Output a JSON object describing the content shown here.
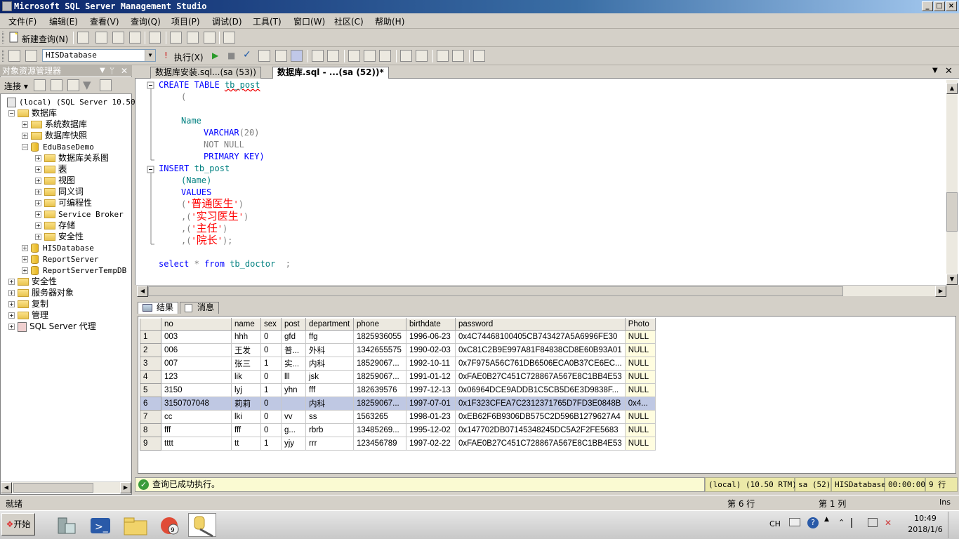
{
  "window": {
    "title": "Microsoft SQL Server Management Studio"
  },
  "menu": [
    "文件(F)",
    "编辑(E)",
    "查看(V)",
    "查询(Q)",
    "项目(P)",
    "调试(D)",
    "工具(T)",
    "窗口(W)",
    "社区(C)",
    "帮助(H)"
  ],
  "toolbar1": {
    "new_query": "新建查询(N)"
  },
  "toolbar2": {
    "database": "HISDatabase",
    "execute": "执行(X)"
  },
  "object_explorer": {
    "title": "对象资源管理器",
    "connect": "连接",
    "server": "(local) (SQL Server 10.50.",
    "databases": "数据库",
    "system_dbs": "系统数据库",
    "snapshots": "数据库快照",
    "edubase": "EduBaseDemo",
    "edu_children": [
      "数据库关系图",
      "表",
      "视图",
      "同义词",
      "可编程性",
      "Service Broker",
      "存储",
      "安全性"
    ],
    "other_dbs": [
      "HISDatabase",
      "ReportServer",
      "ReportServerTempDB"
    ],
    "top_nodes": [
      "安全性",
      "服务器对象",
      "复制",
      "管理",
      "SQL Server 代理"
    ]
  },
  "tabs": [
    {
      "label": "数据库安装.sql...(sa (53))"
    },
    {
      "label": "数据库.sql - ...(sa (52))*"
    }
  ],
  "code": {
    "l1_kw": "CREATE TABLE",
    "l1_id": "tb_post",
    "l2": "(",
    "l4": "Name",
    "l5_kw": "VARCHAR",
    "l5_rest": "(20)",
    "l6": "NOT NULL",
    "l7": "PRIMARY KEY)",
    "l8_kw": "INSERT",
    "l8_id": "tb_post",
    "l9": "(Name)",
    "l10": "VALUES",
    "v1": "普通医生",
    "v2": "实习医生",
    "v3": "主任",
    "v4": "院长",
    "sel_kw": "select",
    "sel_star": "*",
    "sel_from": "from",
    "sel_tbl": "tb_doctor",
    "sel_end": ";"
  },
  "results_tabs": {
    "results": "结果",
    "messages": "消息"
  },
  "grid": {
    "columns": [
      "no",
      "name",
      "sex",
      "post",
      "department",
      "phone",
      "birthdate",
      "password",
      "Photo"
    ],
    "rows": [
      [
        "1",
        "003",
        "hhh",
        "0",
        "gfd",
        "ffg",
        "1825936055",
        "1996-06-23",
        "0x4C74468100405CB743427A5A6996FE30",
        "NULL"
      ],
      [
        "2",
        "006",
        "王发",
        "0",
        "普...",
        "外科",
        "1342655575",
        "1990-02-03",
        "0xC81C2B9E997A81F84838CD8E60B93A01",
        "NULL"
      ],
      [
        "3",
        "007",
        "张三",
        "1",
        "实...",
        "内科",
        "18529067...",
        "1992-10-11",
        "0x7F975A56C761DB6506ECA0B37CE6EC...",
        "NULL"
      ],
      [
        "4",
        "123",
        "lik",
        "0",
        "lll",
        "jsk",
        "18259067...",
        "1991-01-12",
        "0xFAE0B27C451C728867A567E8C1BB4E53",
        "NULL"
      ],
      [
        "5",
        "3150",
        "lyj",
        "1",
        "yhn",
        "fff",
        "182639576",
        "1997-12-13",
        "0x06964DCE9ADDB1C5CB5D6E3D9838F...",
        "NULL"
      ],
      [
        "6",
        "3150707048",
        "莉莉",
        "0",
        "",
        "内科",
        "18259067...",
        "1997-07-01",
        "0x1F323CFEA7C2312371765D7FD3E0848B",
        "0x4..."
      ],
      [
        "7",
        "cc",
        "lki",
        "0",
        "vv",
        "ss",
        "1563265",
        "1998-01-23",
        "0xEB62F6B9306DB575C2D596B1279627A4",
        "NULL"
      ],
      [
        "8",
        "fff",
        "fff",
        "0",
        "g...",
        "rbrb",
        "13485269...",
        "1995-12-02",
        "0x147702DB07145348245DC5A2F2FE5683",
        "NULL"
      ],
      [
        "9",
        "tttt",
        "tt",
        "1",
        "yjy",
        "rrr",
        "123456789",
        "1997-02-22",
        "0xFAE0B27C451C728867A567E8C1BB4E53",
        "NULL"
      ]
    ]
  },
  "query_status": {
    "message": "查询已成功执行。",
    "server": "(local) (10.50 RTM)",
    "user": "sa (52)",
    "db": "HISDatabase",
    "time": "00:00:00",
    "rows": "9 行"
  },
  "statusbar": {
    "ready": "就绪",
    "line": "第 6 行",
    "col": "第 1 列",
    "ins": "Ins"
  },
  "taskbar": {
    "start": "开始",
    "lang": "CH",
    "time": "10:49",
    "date": "2018/1/6"
  }
}
